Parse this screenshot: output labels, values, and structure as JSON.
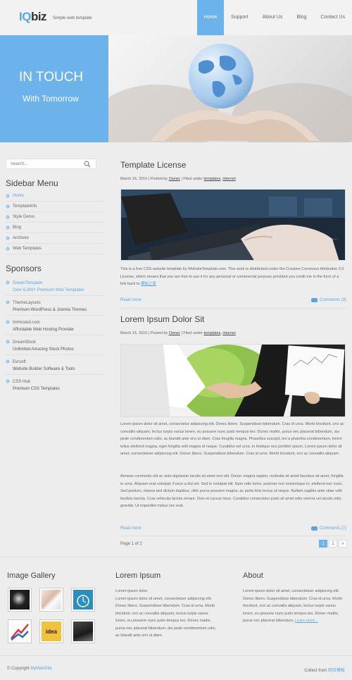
{
  "header": {
    "logo_iq": "IQ",
    "logo_biz": "biz",
    "tagline": "Simple web template",
    "nav": [
      "Home",
      "Support",
      "About Us",
      "Blog",
      "Contact Us"
    ]
  },
  "hero": {
    "title": "IN TOUCH",
    "subtitle": "With Tomorrow"
  },
  "sidebar": {
    "search_placeholder": "Search...",
    "menu_title": "Sidebar Menu",
    "menu": [
      "Home",
      "TemplateInfo",
      "Style Demo",
      "Blog",
      "Archives",
      "Web Templates"
    ],
    "sponsors_title": "Sponsors",
    "sponsors": [
      {
        "name": "DreamTemplate",
        "desc": "Over 6,000+ Premium Web Templates"
      },
      {
        "name": "ThemeLayouts",
        "desc": "Premium WordPress & Joomla Themes"
      },
      {
        "name": "ImHosted.com",
        "desc": "Affordable Web Hosting Provider"
      },
      {
        "name": "DreamStock",
        "desc": "Unlimited Amazing Stock Photos"
      },
      {
        "name": "Evrsoft",
        "desc": "Website Builder Software & Tools"
      },
      {
        "name": "CSS Hub",
        "desc": "Premium CSS Templates"
      }
    ]
  },
  "posts": [
    {
      "title": "Template License",
      "date": "March 16, 2010",
      "posted_by": "Posted by",
      "author": "Owner",
      "filed": "Filed under",
      "cat1": "templates",
      "cat2": "internet",
      "text": "This is a free CSS website template by WebsiteTemplate.com. This work is distributed under the Creative Commons Attribution 3.0 License, which means that you are free to use it for any personal or commercial purpose provided you credit me in the form of a link back to",
      "text_link": "模板之家",
      "read_more": "Read more",
      "comments": "Comments (3)"
    },
    {
      "title": "Lorem Ipsum Dolor Sit",
      "date": "March 15, 2010",
      "posted_by": "Posted by",
      "author": "Owner",
      "filed": "Filed under",
      "cat1": "templates",
      "cat2": "internet",
      "text": "Lorem ipsum dolor sit amet, consectetur adipiscing elit. Donec libero. Suspendisse bibendum. Cras id urna. Morbi tincidunt, orci ac convallis aliquam, lectus turpis varius lorem, eu posuere nunc justo tempus leo. Donec mattis, purus nec placerat bibendum, dui pede condimentum odio, ac blandit ante orci ut diam. Cras fringilla magna. Phasellus suscipit, leo a pharetra condimentum, lorem tellus eleifend magna, eget fringilla velit magna id neque. Curabitur vel urna. In tristique orci porttitor ipsum. Lorem ipsum dolor sit amet, consectetuer adipiscing elit. Donec libero. Suspendisse bibendum. Cras id urna. Morbi tincidunt, orci ac convallis aliquam.",
      "text2": "Aenean commodo elit ac ante dignissim iaculis sit amet non elit. Donec magna sapien, molestie sit amet faucibus sit amet, fringilla in urna. Aliquam erat volutpat. Fusce a dui est. Sed in volutpat elit. Nam odio tortor, pulvinar non scelerisque in, eleifend nec nunc. Sed pretium, massa sed dictum dapibus, nibh purus posuere magna, ac porta felis lectus ut neque. Nullam sagittis ante vitae velit facilisis lacinia. Cras vehicula lacinia ornare. Duis et cursus risus. Curabitur consectetur justo sit amet odio viverra vel iaculis odio gravida. Ut imperdiet metus nec erat.",
      "read_more": "Read more",
      "comments": "Comments (7)"
    }
  ],
  "pager": {
    "label": "Page 1 of 2",
    "pages": [
      "1",
      "2",
      "»"
    ]
  },
  "bottom": {
    "gallery_title": "Image Gallery",
    "lorem_title": "Lorem Ipsum",
    "lorem_subhead": "Lorem ipsum dolor",
    "lorem_text": "Lorem ipsum dolor sit amet, consectetuer adipiscing elit. Donec libero. Suspendisse bibendum. Cras id urna. Morbi tincidunt, orci ac convallis aliquam, lectus turpis varius lorem, eu posuere nunc justo tempus leo. Donec mattis, purus nec placerat bibendum, dui pede condimentum odio, ac blandit ante orci ut diam.",
    "about_title": "About",
    "about_text": "Lorem ipsum dolor sit amet, consectetuer adipiscing elit. Donec libero. Suspendisse bibendum. Cras id urna. Morbi tincidunt, orci ac convallis aliquam, lectus turpis varius lorem, eu posuere nunc justo tempus leo. Donec mattis, purus nec placerat bibendum,",
    "about_link": "Learn more..."
  },
  "footer": {
    "copyright": "© Copyright",
    "site": "MyWebSite",
    "collect": "Collect from",
    "collect_link": "网页模板"
  },
  "colors": {
    "accent": "#6bb3ea",
    "link": "#5aa6e2",
    "background": "#ededed"
  }
}
